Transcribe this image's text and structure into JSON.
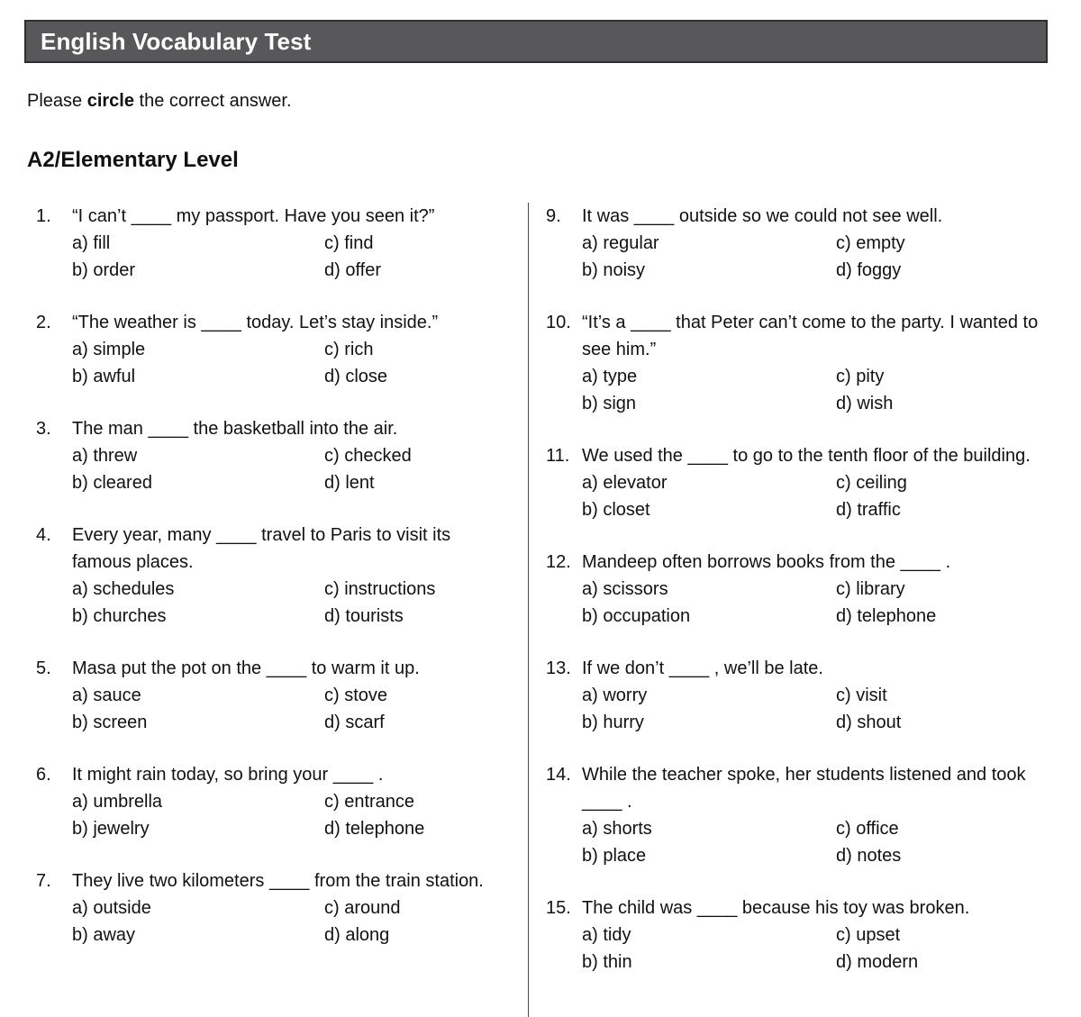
{
  "header": {
    "title": "English Vocabulary Test",
    "bar_color": "#58585A",
    "border_color": "#2F2F30",
    "title_color": "#FFFFFF"
  },
  "intro": {
    "before": "Please ",
    "emphasis": "circle",
    "after": " the correct answer."
  },
  "level_heading": "A2/Elementary Level",
  "blank": "____",
  "columns": {
    "left": {
      "questions": [
        {
          "number": "1.",
          "text": "“I can’t ____ my passport. Have you seen it?”",
          "options": {
            "a": "a) fill",
            "b": "b) order",
            "c": "c) find",
            "d": "d) offer"
          }
        },
        {
          "number": "2.",
          "text": "“The weather is ____ today. Let’s stay inside.”",
          "options": {
            "a": "a) simple",
            "b": "b) awful",
            "c": "c) rich",
            "d": "d) close"
          }
        },
        {
          "number": "3.",
          "text": "The man ____ the basketball into the air.",
          "options": {
            "a": "a) threw",
            "b": "b) cleared",
            "c": "c) checked",
            "d": "d) lent"
          }
        },
        {
          "number": "4.",
          "text": "Every year, many ____ travel to Paris to visit its famous places.",
          "options": {
            "a": "a) schedules",
            "b": "b) churches",
            "c": "c) instructions",
            "d": "d) tourists"
          }
        },
        {
          "number": "5.",
          "text": "Masa put the pot on the ____ to warm it up.",
          "options": {
            "a": "a) sauce",
            "b": "b) screen",
            "c": "c) stove",
            "d": "d) scarf"
          }
        },
        {
          "number": "6.",
          "text": "It might rain today, so bring your ____ .",
          "options": {
            "a": "a) umbrella",
            "b": "b) jewelry",
            "c": "c) entrance",
            "d": "d) telephone"
          }
        },
        {
          "number": "7.",
          "text": "They live two kilometers ____ from the train station.",
          "options": {
            "a": "a) outside",
            "b": "b) away",
            "c": "c) around",
            "d": "d) along"
          }
        }
      ]
    },
    "right": {
      "questions": [
        {
          "number": "9.",
          "text": "It was ____ outside so we could not see well.",
          "options": {
            "a": "a) regular",
            "b": "b) noisy",
            "c": "c) empty",
            "d": "d) foggy"
          }
        },
        {
          "number": "10.",
          "text": "“It’s a ____ that Peter can’t come to the party. I wanted to see him.”",
          "options": {
            "a": "a) type",
            "b": "b) sign",
            "c": "c) pity",
            "d": "d) wish"
          }
        },
        {
          "number": "11.",
          "text": "We used the ____ to go to the tenth floor of the building.",
          "options": {
            "a": "a) elevator",
            "b": "b) closet",
            "c": "c) ceiling",
            "d": "d) traffic"
          }
        },
        {
          "number": "12.",
          "text": "Mandeep often borrows books from the ____ .",
          "options": {
            "a": "a) scissors",
            "b": "b) occupation",
            "c": "c) library",
            "d": "d) telephone"
          }
        },
        {
          "number": "13.",
          "text": "If we don’t ____ , we’ll be late.",
          "options": {
            "a": "a) worry",
            "b": "b) hurry",
            "c": "c) visit",
            "d": "d) shout"
          }
        },
        {
          "number": "14.",
          "text": "While the teacher spoke, her students listened and took ____ .",
          "options": {
            "a": "a) shorts",
            "b": "b) place",
            "c": "c) office",
            "d": "d) notes"
          }
        },
        {
          "number": "15.",
          "text": "The child was ____ because his toy was broken.",
          "options": {
            "a": "a) tidy",
            "b": "b) thin",
            "c": "c) upset",
            "d": "d) modern"
          }
        }
      ]
    }
  }
}
